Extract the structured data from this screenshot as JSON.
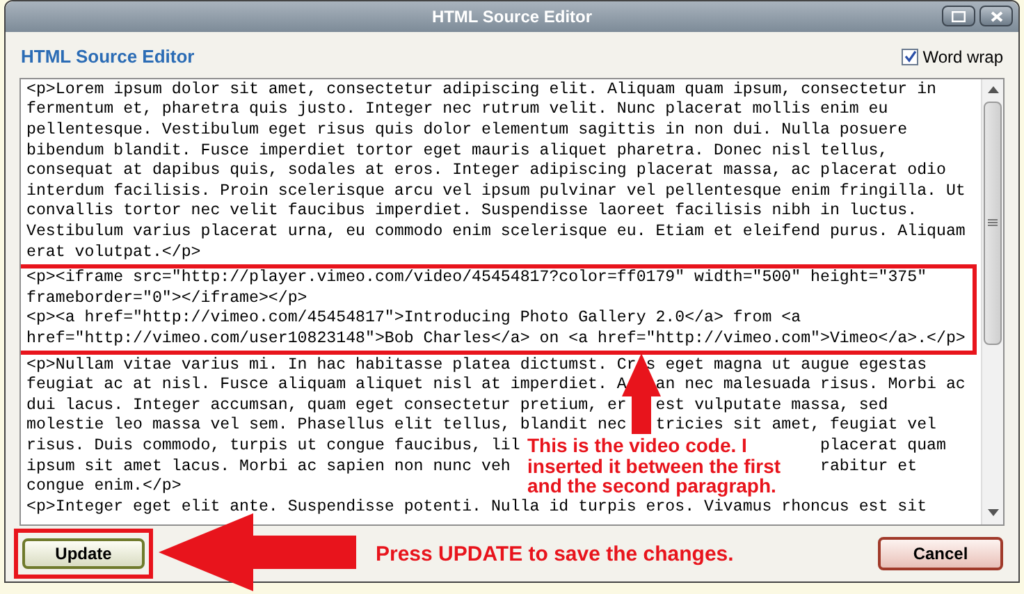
{
  "window": {
    "title": "HTML Source Editor"
  },
  "header": {
    "title": "HTML Source Editor",
    "word_wrap": {
      "label": "Word wrap",
      "checked": true
    }
  },
  "editor": {
    "lines": [
      {
        "segments": [
          "<p>Lorem ipsum dolor sit amet, consectetur adipiscing elit. Aliquam quam ipsum, consectetur in"
        ],
        "highlighted": false
      },
      {
        "segments": [
          "fermentum et, pharetra quis justo. Integer nec rutrum velit. Nunc placerat mollis enim eu"
        ],
        "highlighted": false
      },
      {
        "segments": [
          "pellentesque. Vestibulum eget risus quis dolor elementum sagittis in non dui. Nulla posuere"
        ],
        "highlighted": false
      },
      {
        "segments": [
          "bibendum blandit. Fusce imperdiet tortor eget mauris aliquet pharetra. Donec nisl tellus,"
        ],
        "highlighted": false
      },
      {
        "segments": [
          "consequat at dapibus quis, sodales at eros. Integer adipiscing placerat massa, ac placerat odio"
        ],
        "highlighted": false
      },
      {
        "segments": [
          "interdum facilisis. Proin scelerisque arcu vel ipsum pulvinar vel pellentesque enim fringilla. Ut"
        ],
        "highlighted": false
      },
      {
        "segments": [
          "convallis tortor nec velit faucibus imperdiet. Suspendisse laoreet facilisis nibh in luctus."
        ],
        "highlighted": false
      },
      {
        "segments": [
          "Vestibulum varius placerat urna, eu commodo enim scelerisque eu. Etiam et eleifend purus. Aliquam"
        ],
        "highlighted": false
      },
      {
        "segments": [
          "erat volutpat.</p>"
        ],
        "highlighted": false
      },
      {
        "segments": [
          "<p><iframe src=\"http://player.vimeo.com/video/45454817?color=ff0179\" width=\"500\" height=\"375\""
        ],
        "highlighted": true
      },
      {
        "segments": [
          "frameborder=\"0\"></iframe></p>"
        ],
        "highlighted": true
      },
      {
        "segments": [
          "<p><a href=\"http://vimeo.com/45454817\">Introducing Photo Gallery 2.0</a> from <a"
        ],
        "highlighted": true
      },
      {
        "segments": [
          "href=\"http://vimeo.com/user10823148\">Bob Charles</a> on <a href=\"http://vimeo.com\">Vimeo</a>.</p>"
        ],
        "highlighted": true
      },
      {
        "segments": [
          "<p>Nullam vitae varius mi. In hac habitasse platea dictumst. Cr",
          " s eget magna ut augue egestas"
        ],
        "highlighted": false
      },
      {
        "segments": [
          "feugiat ac at nisl. Fusce aliquam aliquet nisl at imperdiet. A",
          "   an nec malesuada risus. Morbi ac"
        ],
        "highlighted": false
      },
      {
        "segments": [
          "dui lacus. Integer accumsan, quam eget consectetur pretium, er",
          "   est vulputate massa, sed"
        ],
        "highlighted": false
      },
      {
        "segments": [
          "molestie leo massa vel sem. Phasellus elit tellus, blandit nec",
          "   tricies sit amet, feugiat vel"
        ],
        "highlighted": false
      },
      {
        "segments": [
          "risus. Duis commodo, turpis ut congue faucibus, lil",
          "                               placerat quam"
        ],
        "highlighted": false
      },
      {
        "segments": [
          "ipsum sit amet lacus. Morbi ac sapien non nunc veh",
          "                                rabitur et"
        ],
        "highlighted": false
      },
      {
        "segments": [
          "congue enim.</p>"
        ],
        "highlighted": false
      },
      {
        "segments": [
          "<p>Integer eget elit ante. Suspendisse potenti. Nulla id turpis eros. Vivamus rhoncus est sit"
        ],
        "highlighted": false
      }
    ]
  },
  "annotations": {
    "callout": [
      "This is the video code. I",
      "inserted it between the first",
      "and the second paragraph."
    ],
    "update_hint": "Press UPDATE to save the changes."
  },
  "buttons": {
    "update": "Update",
    "cancel": "Cancel"
  }
}
